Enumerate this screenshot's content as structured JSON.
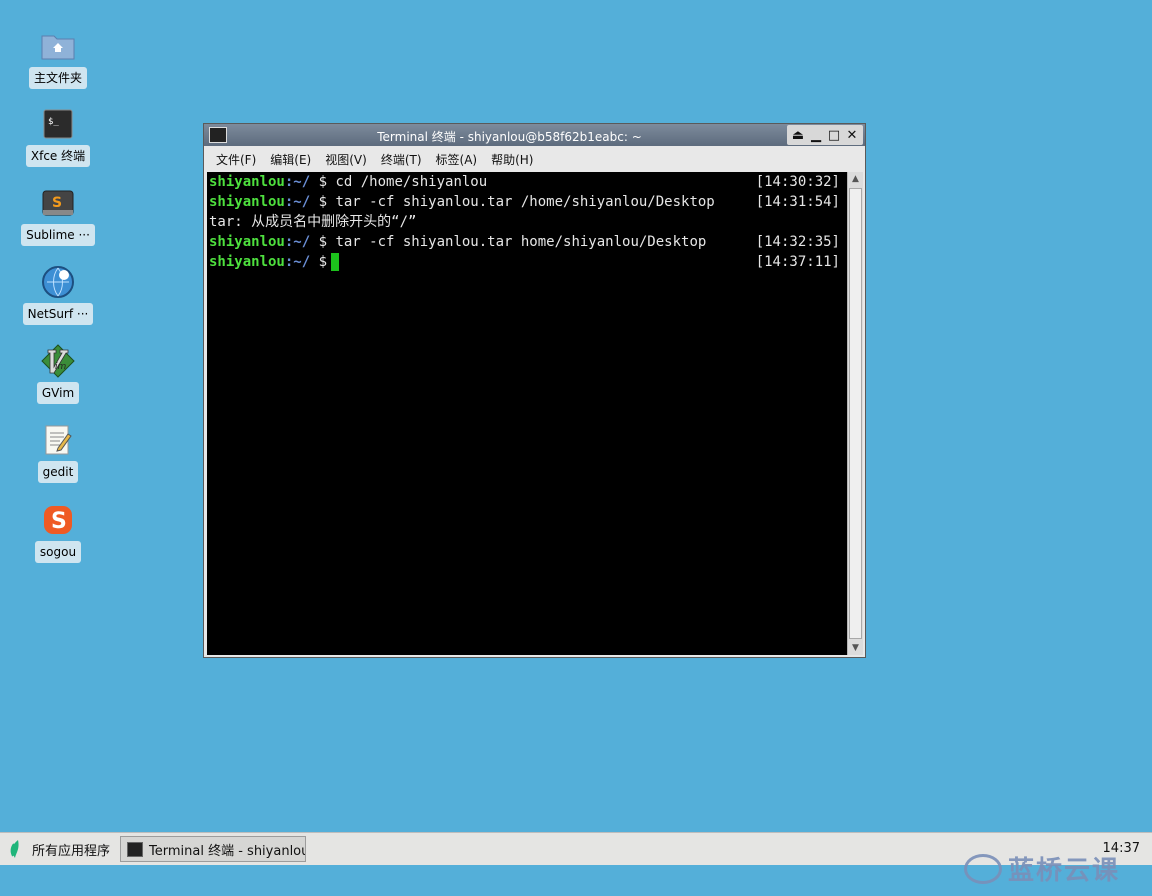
{
  "desktop": {
    "icons": [
      {
        "label": "主文件夹",
        "icon": "home-folder-icon"
      },
      {
        "label": "Xfce 终端",
        "icon": "terminal-icon"
      },
      {
        "label": "Sublime ···",
        "icon": "sublime-icon"
      },
      {
        "label": "NetSurf ···",
        "icon": "netsurf-icon"
      },
      {
        "label": "GVim",
        "icon": "gvim-icon"
      },
      {
        "label": "gedit",
        "icon": "gedit-icon"
      },
      {
        "label": "sogou",
        "icon": "sogou-icon"
      }
    ]
  },
  "window": {
    "title": "Terminal 终端 - shiyanlou@b58f62b1eabc: ~",
    "menus": [
      "文件(F)",
      "编辑(E)",
      "视图(V)",
      "终端(T)",
      "标签(A)",
      "帮助(H)"
    ],
    "lines": [
      {
        "user": "shiyanlou",
        "path": ":~/",
        "cmd": " $ cd /home/shiyanlou",
        "time": "[14:30:32]"
      },
      {
        "user": "shiyanlou",
        "path": ":~/",
        "cmd": " $ tar -cf shiyanlou.tar /home/shiyanlou/Desktop",
        "time": "[14:31:54]"
      },
      {
        "text": "tar: 从成员名中删除开头的“/”"
      },
      {
        "user": "shiyanlou",
        "path": ":~/",
        "cmd": " $ tar -cf shiyanlou.tar home/shiyanlou/Desktop",
        "time": "[14:32:35]"
      },
      {
        "user": "shiyanlou",
        "path": ":~/",
        "cmd": " $",
        "time": "[14:37:11]",
        "cursor": true
      }
    ]
  },
  "taskbar": {
    "menu_label": "所有应用程序",
    "task_label": "Terminal 终端 - shiyanlou@···",
    "clock": "14:37"
  },
  "watermark": "蓝桥云课",
  "colors": {
    "desktop_bg": "#54afd9",
    "prompt_user": "#4ee03e",
    "prompt_path": "#6b8fd6",
    "cursor": "#1cc21c"
  }
}
